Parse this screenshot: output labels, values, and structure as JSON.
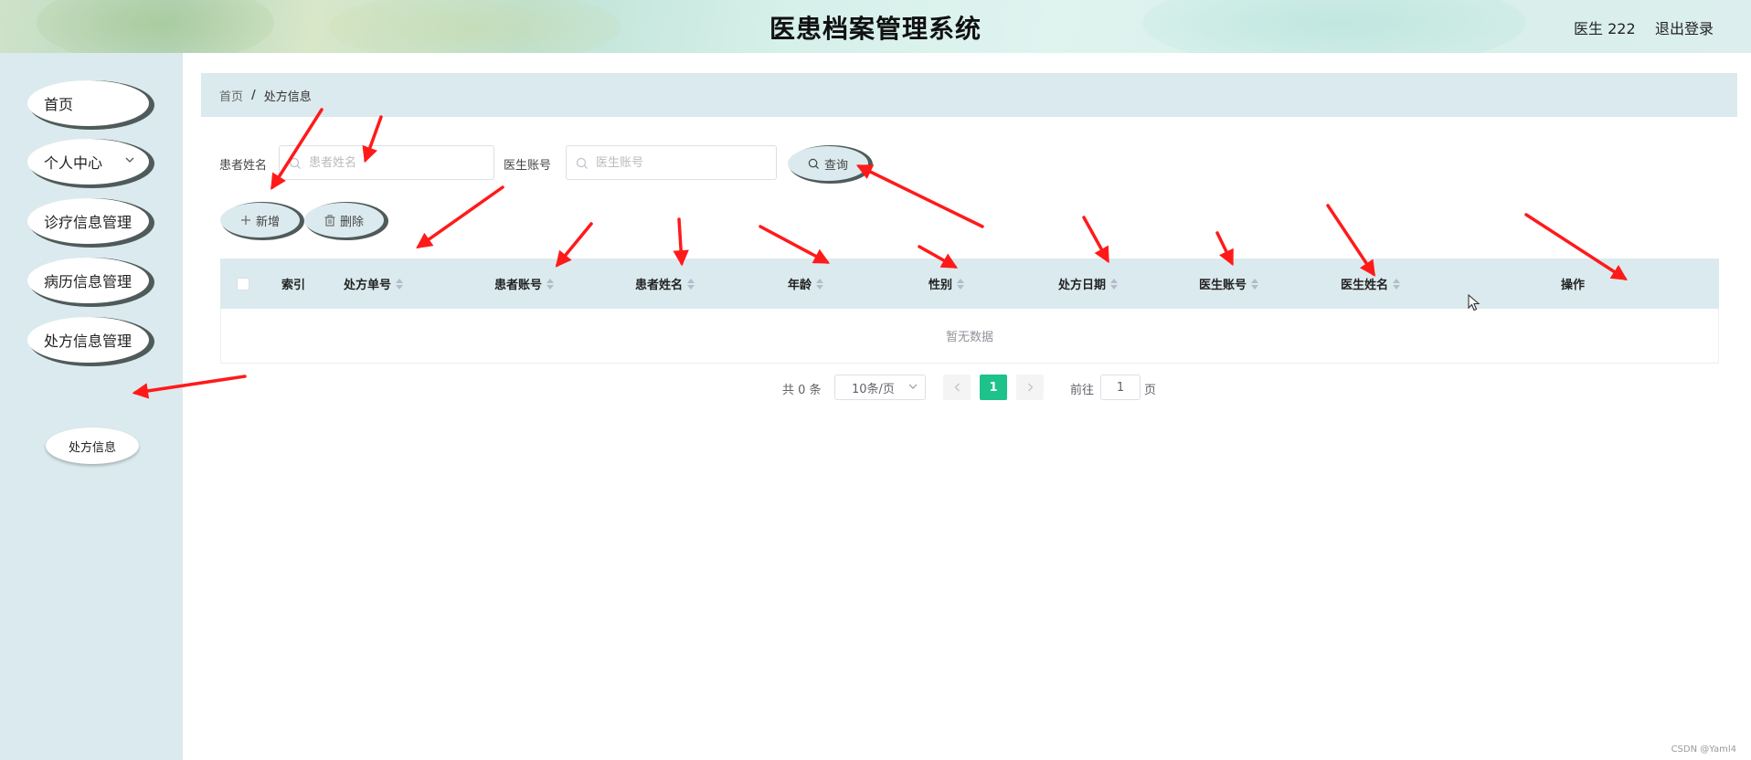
{
  "header": {
    "title": "医患档案管理系统",
    "user": "医生 222",
    "logout": "退出登录"
  },
  "sidebar": {
    "items": [
      {
        "label": "首页"
      },
      {
        "label": "个人中心"
      },
      {
        "label": "诊疗信息管理"
      },
      {
        "label": "病历信息管理"
      },
      {
        "label": "处方信息管理"
      }
    ],
    "sub_item": "处方信息"
  },
  "breadcrumb": {
    "home": "首页",
    "separator": "/",
    "current": "处方信息"
  },
  "search": {
    "patient_name_label": "患者姓名",
    "patient_name_placeholder": "患者姓名",
    "doctor_account_label": "医生账号",
    "doctor_account_placeholder": "医生账号",
    "query_button": "查询"
  },
  "actions": {
    "add": "新增",
    "delete": "删除"
  },
  "table": {
    "columns": [
      "索引",
      "处方单号",
      "患者账号",
      "患者姓名",
      "年龄",
      "性别",
      "处方日期",
      "医生账号",
      "医生姓名",
      "操作"
    ],
    "empty_text": "暂无数据"
  },
  "pagination": {
    "total": "共 0 条",
    "page_size": "10条/页",
    "current_page": "1",
    "goto_label": "前往",
    "goto_value": "1",
    "page_suffix": "页"
  },
  "watermark": "CSDN @Yaml4",
  "colors": {
    "accent": "#1ec28b",
    "panel": "#dbeaee",
    "annotation_arrow": "#ff1a1a"
  }
}
